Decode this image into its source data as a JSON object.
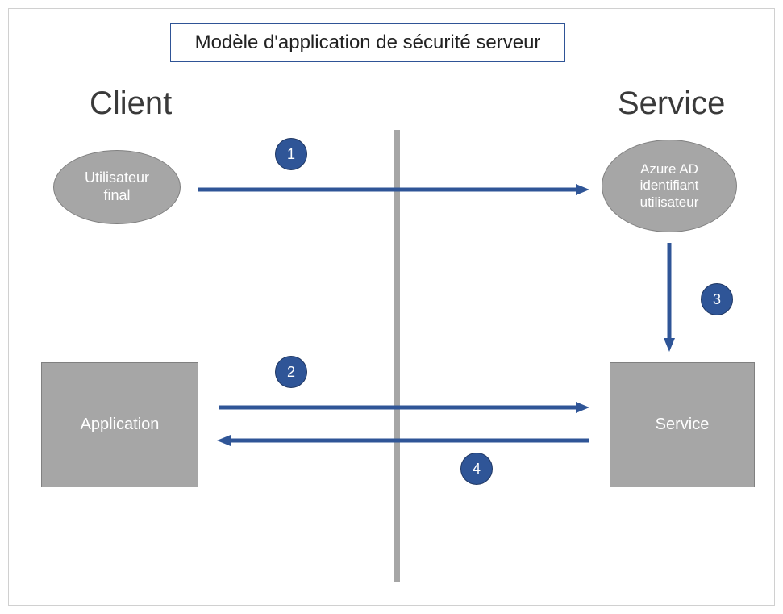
{
  "title": "Modèle d'application de sécurité serveur",
  "headings": {
    "client": "Client",
    "service": "Service"
  },
  "nodes": {
    "user": "Utilisateur\nfinal",
    "azure": "Azure AD\nidentifiant\nutilisateur",
    "application": "Application",
    "service": "Service"
  },
  "steps": {
    "s1": "1",
    "s2": "2",
    "s3": "3",
    "s4": "4"
  }
}
